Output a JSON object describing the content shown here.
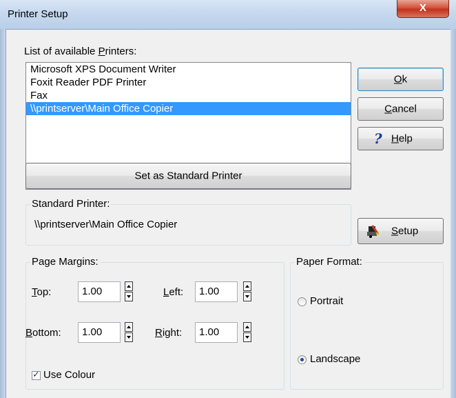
{
  "window": {
    "title": "Printer Setup",
    "close_glyph": "X"
  },
  "printers": {
    "label_pre": "List of available ",
    "label_u": "P",
    "label_post": "rinters:",
    "items": [
      "Microsoft XPS Document Writer",
      "Foxit Reader PDF Printer",
      "Fax",
      "\\\\printserver\\Main Office Copier"
    ],
    "selected_index": 3
  },
  "buttons": {
    "ok_u": "O",
    "ok_rest": "k",
    "cancel_u": "C",
    "cancel_rest": "ancel",
    "help_u": "H",
    "help_rest": "elp",
    "setup_u": "S",
    "setup_rest": "etup",
    "set_standard": "Set as Standard Printer"
  },
  "standard_printer": {
    "title": "Standard Printer:",
    "value": "\\\\printserver\\Main Office Copier"
  },
  "margins": {
    "title": "Page Margins:",
    "top": {
      "label_u": "T",
      "label_rest": "op:",
      "value": "1.00"
    },
    "left": {
      "label_u": "L",
      "label_rest": "eft:",
      "value": "1.00"
    },
    "bottom": {
      "label_u": "B",
      "label_rest": "ottom:",
      "value": "1.00"
    },
    "right": {
      "label_u": "R",
      "label_rest": "ight:",
      "value": "1.00"
    },
    "use_colour": {
      "label": "Use Colour",
      "checked": true
    }
  },
  "paper_format": {
    "title": "Paper Format:",
    "portrait": "Portrait",
    "landscape": "Landscape",
    "selected": "Landscape"
  },
  "icons": {
    "help": "question-mark",
    "setup": "printer-wrench",
    "close": "close-x"
  }
}
